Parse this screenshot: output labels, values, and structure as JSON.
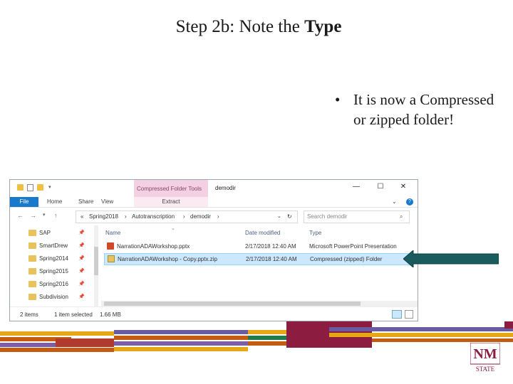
{
  "slide": {
    "title_prefix": "Step 2b: Note the ",
    "title_bold": "Type",
    "bullet": "•",
    "bullet_text": "It is now a Compressed or zipped folder!"
  },
  "window": {
    "context_tab_header": "Compressed Folder Tools",
    "title": "demodir",
    "ribbon_tabs": [
      "File",
      "Home",
      "Share",
      "View"
    ],
    "context_tab": "Extract",
    "breadcrumb_prefix": "«",
    "breadcrumbs": [
      "Spring2018",
      "Autotranscription",
      "demodir"
    ],
    "search_placeholder": "Search demodir",
    "nav_items": [
      "SAP",
      "SmartDrew",
      "Spring2014",
      "Spring2015",
      "Spring2016",
      "Subdivision"
    ],
    "columns": {
      "name": "Name",
      "date": "Date modified",
      "type": "Type"
    },
    "files": [
      {
        "name": "NarrationADAWorkshop.pptx",
        "date": "2/17/2018 12:40 AM",
        "type": "Microsoft PowerPoint Presentation",
        "selected": false
      },
      {
        "name": "NarrationADAWorkshop - Copy.pptx.zip",
        "date": "2/17/2018 12:40 AM",
        "type": "Compressed (zipped) Folder",
        "selected": true
      }
    ],
    "status": {
      "items": "2 items",
      "selection": "1 item selected",
      "size": "1.66 MB"
    },
    "icons": [
      "folder-icon",
      "properties-icon",
      "new-folder-icon",
      "minimize-icon",
      "maximize-icon",
      "close-icon",
      "back-arrow-icon",
      "forward-arrow-icon",
      "recent-chevron-icon",
      "up-arrow-icon",
      "refresh-icon",
      "search-icon",
      "help-icon",
      "chevron-icon",
      "pin-icon",
      "powerpoint-file-icon",
      "zip-folder-icon",
      "details-view-icon",
      "large-icons-view-icon"
    ],
    "colors": {
      "accent": "#1979ca",
      "context_tab": "#f3d0e2",
      "selection": "#cce8ff"
    }
  },
  "callout_arrow": {
    "color": "#1a5c5e"
  },
  "logo": {
    "line1": "NM",
    "line2": "STATE",
    "color": "#8c1d40"
  }
}
